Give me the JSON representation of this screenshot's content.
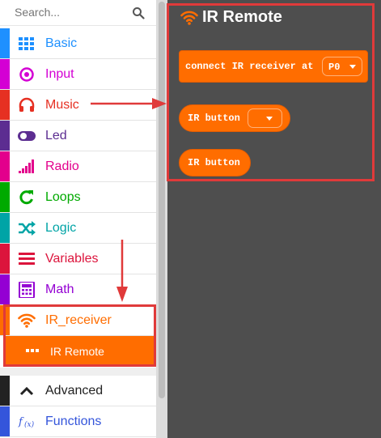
{
  "search": {
    "placeholder": "Search..."
  },
  "categories": [
    {
      "label": "Basic",
      "color": "#1e90ff",
      "icon": "grid-icon"
    },
    {
      "label": "Input",
      "color": "#d400d4",
      "icon": "target-icon"
    },
    {
      "label": "Music",
      "color": "#e63022",
      "icon": "headphones-icon"
    },
    {
      "label": "Led",
      "color": "#5c2d91",
      "icon": "toggle-icon"
    },
    {
      "label": "Radio",
      "color": "#e3008c",
      "icon": "signal-bars-icon"
    },
    {
      "label": "Loops",
      "color": "#00aa00",
      "icon": "refresh-icon"
    },
    {
      "label": "Logic",
      "color": "#00a4a6",
      "icon": "shuffle-icon"
    },
    {
      "label": "Variables",
      "color": "#dc143c",
      "icon": "list-icon"
    },
    {
      "label": "Math",
      "color": "#9400d3",
      "icon": "calculator-icon"
    },
    {
      "label": "IR_receiver",
      "color": "#ff6d00",
      "icon": "wifi-icon"
    }
  ],
  "subcategory": {
    "label": "IR Remote",
    "icon": "dots-icon"
  },
  "advanced": [
    {
      "label": "Advanced",
      "color": "#222222",
      "icon": "chevron-up-icon"
    },
    {
      "label": "Functions",
      "color": "#3455db",
      "icon": "function-icon"
    }
  ],
  "flyout": {
    "title": "IR Remote",
    "title_icon": "wifi-icon",
    "blocks": [
      {
        "text": "connect IR receiver at",
        "dropdown": "P0"
      },
      {
        "text": "IR button",
        "dropdown": ""
      },
      {
        "text": "IR button"
      }
    ]
  },
  "colors": {
    "workspace": "#4e4e4e",
    "block": "#ff6d00",
    "annotation": "#e03a3a"
  }
}
